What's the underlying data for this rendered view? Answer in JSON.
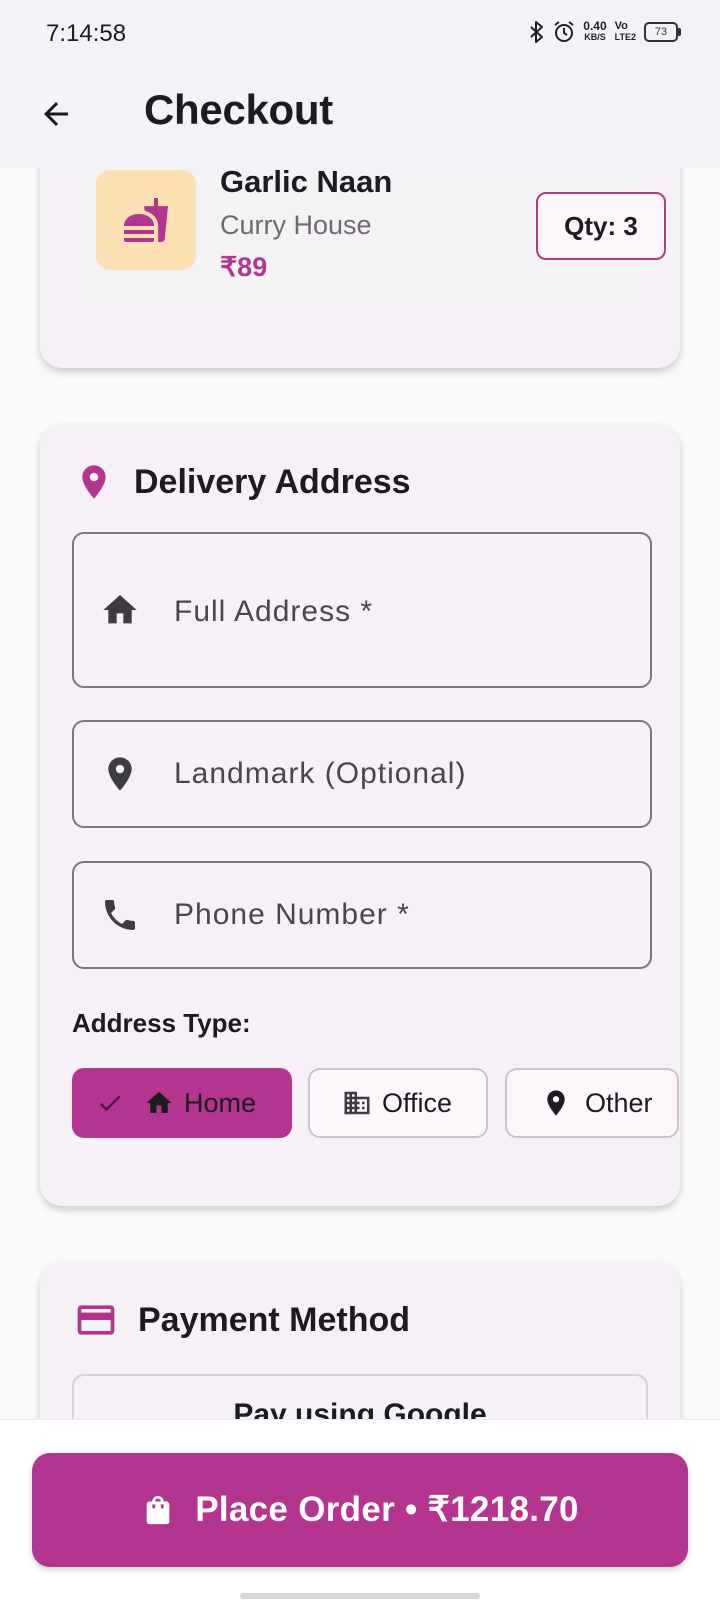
{
  "status_bar": {
    "time": "7:14:58",
    "net_speed": "0.40",
    "net_unit": "KB/S",
    "volte_top": "Vo",
    "volte_bottom": "LTE2",
    "battery": "73"
  },
  "app_bar": {
    "title": "Checkout",
    "back_icon": "arrow-back-icon"
  },
  "cart_item": {
    "name": "Garlic Naan",
    "restaurant": "Curry House",
    "price": "₹89",
    "quantity": "Qty: 3",
    "thumb_icon": "fastfood-icon",
    "thumb_bg": "#fde1b5"
  },
  "delivery": {
    "title": "Delivery Address",
    "fields": [
      {
        "icon": "home-icon",
        "placeholder": "Full Address *",
        "value": ""
      },
      {
        "icon": "location-pin-icon",
        "placeholder": "Landmark (Optional)",
        "value": ""
      },
      {
        "icon": "phone-icon",
        "placeholder": "Phone Number *",
        "value": ""
      }
    ],
    "address_type_label": "Address Type:",
    "address_types": [
      {
        "label": "Home",
        "icon": "home-icon",
        "selected": true
      },
      {
        "label": "Office",
        "icon": "business-icon",
        "selected": false
      },
      {
        "label": "Other",
        "icon": "location-pin-icon",
        "selected": false
      }
    ]
  },
  "payment": {
    "title": "Payment Method",
    "option_label": "Pay using Google"
  },
  "checkout": {
    "button_label": "Place Order • ₹1218.70"
  },
  "colors": {
    "accent": "#b3358f",
    "card_bg": "#f6f1f7",
    "app_bar_bg": "#f3f2f7"
  }
}
